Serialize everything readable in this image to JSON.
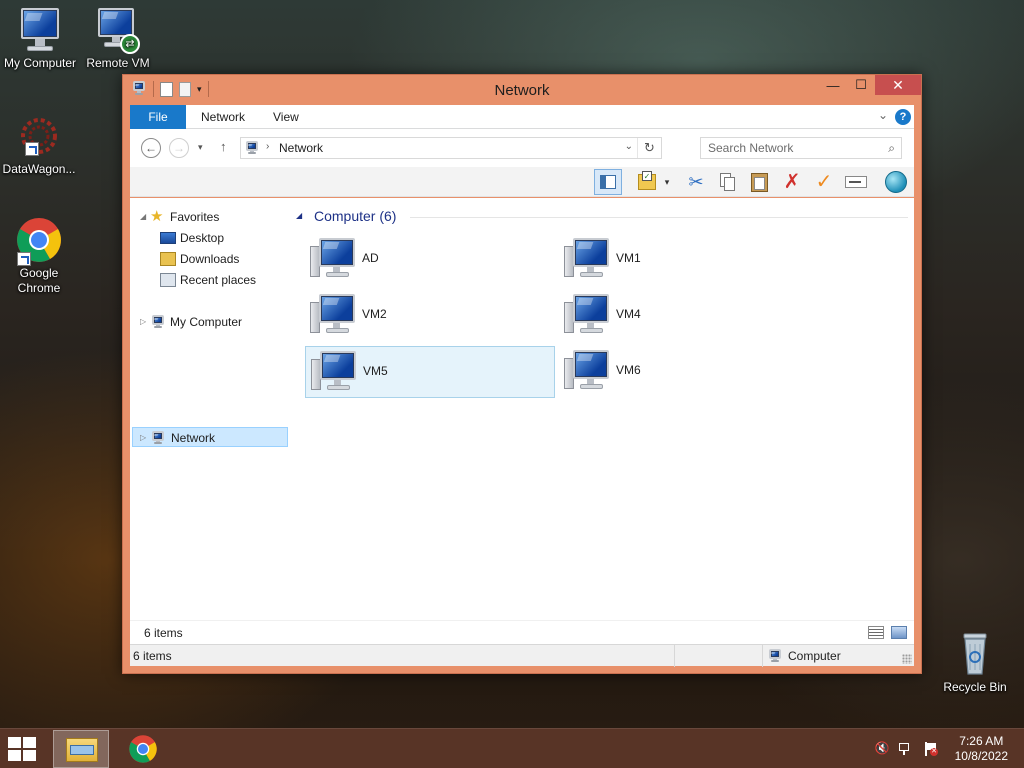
{
  "desktop": {
    "icons": [
      {
        "label": "My Computer"
      },
      {
        "label": "Remote VM"
      },
      {
        "label": "DataWagon..."
      },
      {
        "label": "Google Chrome"
      },
      {
        "label": "Recycle Bin"
      }
    ]
  },
  "window": {
    "title": "Network",
    "controls": {
      "minimize": "—",
      "maximize": "☐",
      "close": "✕"
    },
    "ribbon": {
      "tabs": [
        {
          "label": "File"
        },
        {
          "label": "Network"
        },
        {
          "label": "View"
        }
      ],
      "help": "?"
    },
    "nav": {
      "address": "Network",
      "search_placeholder": "Search Network"
    },
    "tree": {
      "favorites": "Favorites",
      "desktop": "Desktop",
      "downloads": "Downloads",
      "recent": "Recent places",
      "my_computer": "My Computer",
      "network": "Network"
    },
    "group_header": "Computer (6)",
    "items": [
      {
        "name": "AD"
      },
      {
        "name": "VM1"
      },
      {
        "name": "VM2"
      },
      {
        "name": "VM4"
      },
      {
        "name": "VM5",
        "selected": true
      },
      {
        "name": "VM6"
      }
    ],
    "details_count": "6 items",
    "status": {
      "left": "6 items",
      "right": "Computer"
    }
  },
  "taskbar": {
    "time": "7:26 AM",
    "date": "10/8/2022"
  },
  "colors": {
    "window_frame": "#e8906a",
    "close_button": "#c74f4f",
    "file_tab": "#1979ca",
    "selection": "#cce8ff"
  }
}
